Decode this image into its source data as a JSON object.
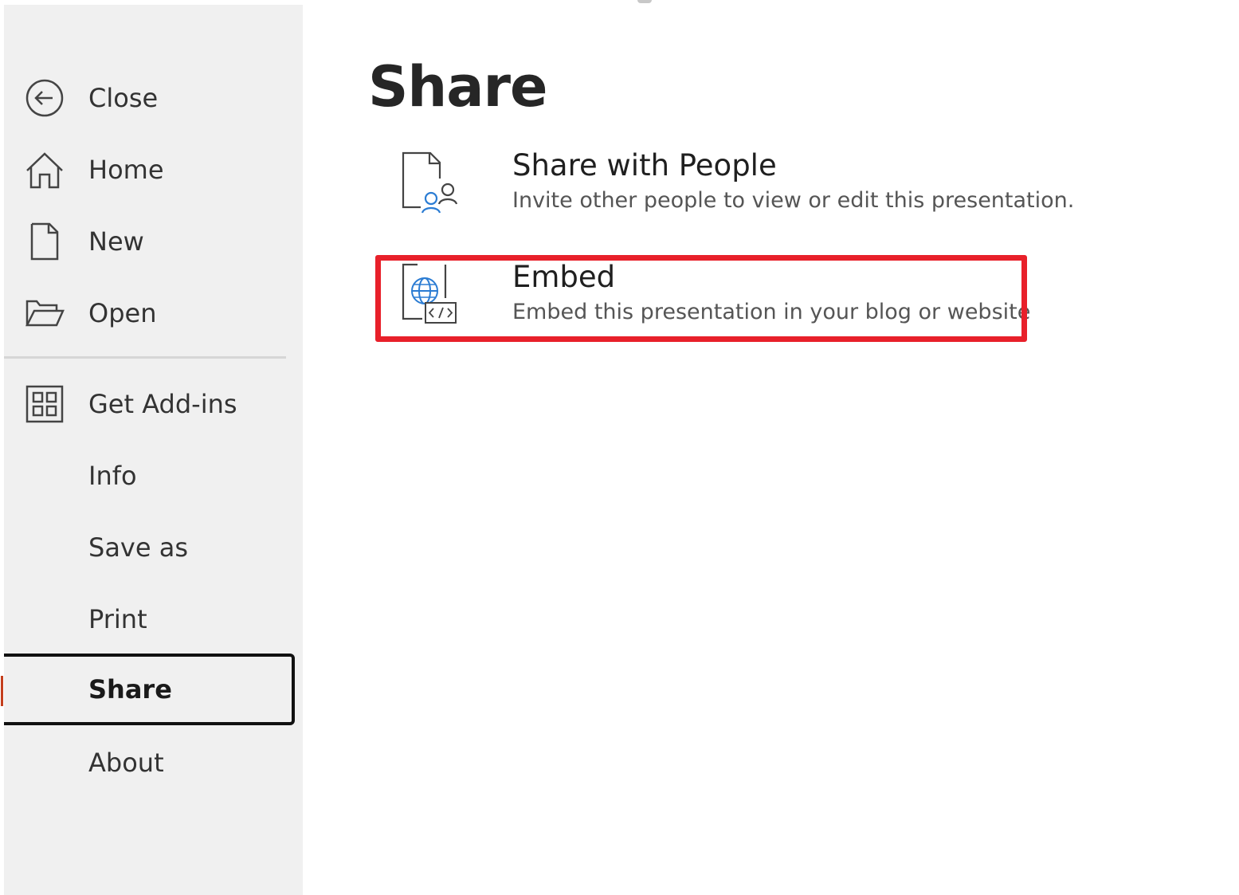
{
  "sidebar": {
    "items": [
      {
        "label": "Close",
        "icon": "back-arrow-icon"
      },
      {
        "label": "Home",
        "icon": "home-icon"
      },
      {
        "label": "New",
        "icon": "new-document-icon"
      },
      {
        "label": "Open",
        "icon": "folder-open-icon"
      },
      {
        "label": "Get Add-ins",
        "icon": "add-ins-grid-icon"
      },
      {
        "label": "Info"
      },
      {
        "label": "Save as"
      },
      {
        "label": "Print"
      },
      {
        "label": "Share",
        "active": true
      },
      {
        "label": "About"
      }
    ]
  },
  "main": {
    "title": "Share",
    "options": [
      {
        "title": "Share with People",
        "description": "Invite other people to view or edit this presentation.",
        "icon": "share-people-icon"
      },
      {
        "title": "Embed",
        "description": "Embed this presentation in your blog or website",
        "icon": "embed-web-icon",
        "highlighted": true
      }
    ]
  },
  "colors": {
    "sidebar_bg": "#f0f0f0",
    "highlight": "#e8202a",
    "accent": "#c43e1c",
    "icon_blue": "#2b7cd3"
  }
}
